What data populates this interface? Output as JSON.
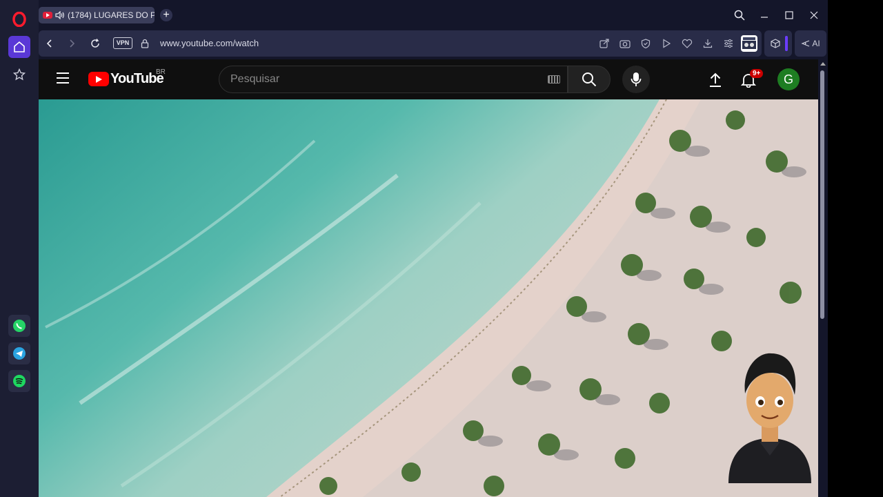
{
  "browser": {
    "tab_title": "(1784) LUGARES DO P",
    "url": "www.youtube.com/watch",
    "vpn_label": "VPN",
    "ai_label": "AI"
  },
  "youtube": {
    "logo_text": "YouTube",
    "country_code": "BR",
    "search_placeholder": "Pesquisar",
    "notification_count": "9+",
    "avatar_initial": "G"
  },
  "colors": {
    "opera_red": "#ff1b2d",
    "sidebar_active": "#5a38d6",
    "yt_red": "#ff0000",
    "avatar_bg": "#1e7d22"
  }
}
